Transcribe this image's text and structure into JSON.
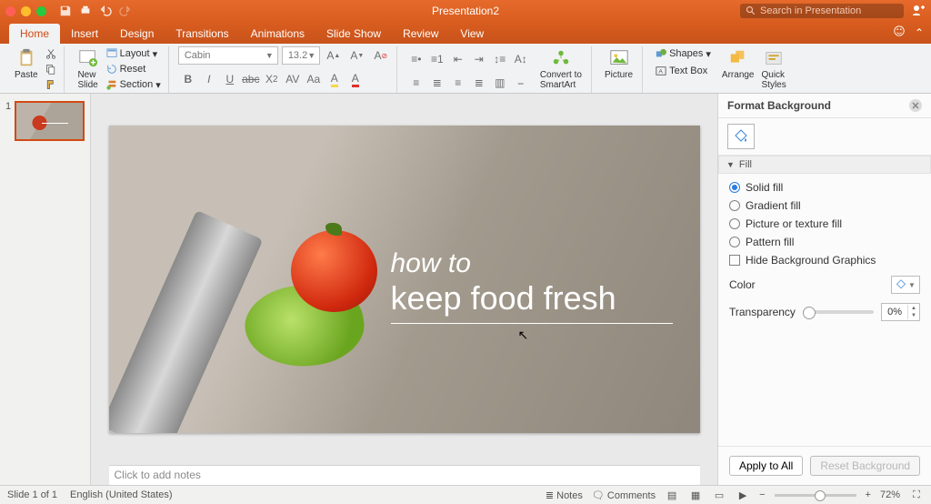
{
  "title": "Presentation2",
  "search_placeholder": "Search in Presentation",
  "tabs": {
    "home": "Home",
    "insert": "Insert",
    "design": "Design",
    "transitions": "Transitions",
    "animations": "Animations",
    "slideshow": "Slide Show",
    "review": "Review",
    "view": "View"
  },
  "ribbon": {
    "paste": "Paste",
    "new_slide": "New\nSlide",
    "layout": "Layout",
    "reset": "Reset",
    "section": "Section",
    "font_name": "Cabin",
    "font_size": "13.2",
    "convert": "Convert to\nSmartArt",
    "picture": "Picture",
    "shapes": "Shapes",
    "textbox": "Text Box",
    "arrange": "Arrange",
    "quickstyles": "Quick\nStyles"
  },
  "slide": {
    "number": "1",
    "title1": "how to",
    "title2": "keep food fresh"
  },
  "notes_placeholder": "Click to add notes",
  "format_pane": {
    "title": "Format Background",
    "fill_header": "Fill",
    "solid": "Solid fill",
    "gradient": "Gradient fill",
    "picture": "Picture or texture fill",
    "pattern": "Pattern fill",
    "hide": "Hide Background Graphics",
    "color": "Color",
    "transparency": "Transparency",
    "transparency_value": "0%",
    "apply_all": "Apply to All",
    "reset": "Reset Background"
  },
  "status": {
    "slide": "Slide 1 of 1",
    "lang": "English (United States)",
    "notes": "Notes",
    "comments": "Comments",
    "zoom": "72%"
  }
}
